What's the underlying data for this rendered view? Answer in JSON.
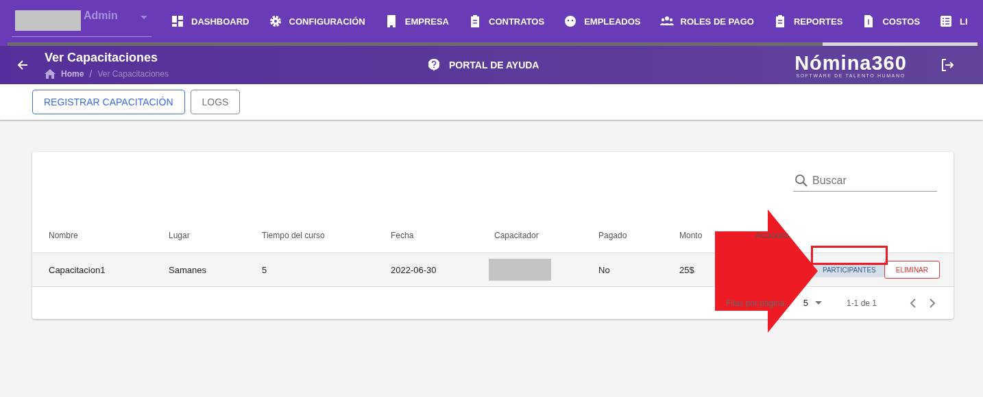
{
  "user_menu": {
    "label": "Admin"
  },
  "nav": [
    {
      "label": "DASHBOARD"
    },
    {
      "label": "CONFIGURACIÓN"
    },
    {
      "label": "EMPRESA"
    },
    {
      "label": "CONTRATOS"
    },
    {
      "label": "EMPLEADOS"
    },
    {
      "label": "ROLES DE PAGO"
    },
    {
      "label": "REPORTES"
    },
    {
      "label": "COSTOS"
    },
    {
      "label": "LI"
    }
  ],
  "header": {
    "title": "Ver Capacitaciones",
    "breadcrumb": [
      "Home",
      "Ver Capacitaciones"
    ],
    "breadcrumb_separator": "/",
    "help": "PORTAL DE AYUDA",
    "logo": "Nómina360",
    "logo_tagline": "SOFTWARE DE TALENTO HUMANO"
  },
  "toolbar": [
    "REGISTRAR CAPACITACIÓN",
    "LOGS"
  ],
  "search": {
    "placeholder": "Buscar"
  },
  "table": {
    "columns": [
      "Nombre",
      "Lugar",
      "Tiempo del curso",
      "Fecha",
      "Capacitador",
      "Pagado",
      "Monto",
      "Acciones"
    ],
    "rows": [
      {
        "cells": [
          "Capacitacion1",
          "Samanes",
          "5",
          "2022-06-30",
          "",
          "No",
          "25$"
        ],
        "actions": [
          "PARTICIPANTES",
          "ELIMINAR"
        ]
      }
    ]
  },
  "footer": {
    "rows_label": "Filas por página:",
    "rows_per_page": "5",
    "range": "1-1 de 1"
  }
}
